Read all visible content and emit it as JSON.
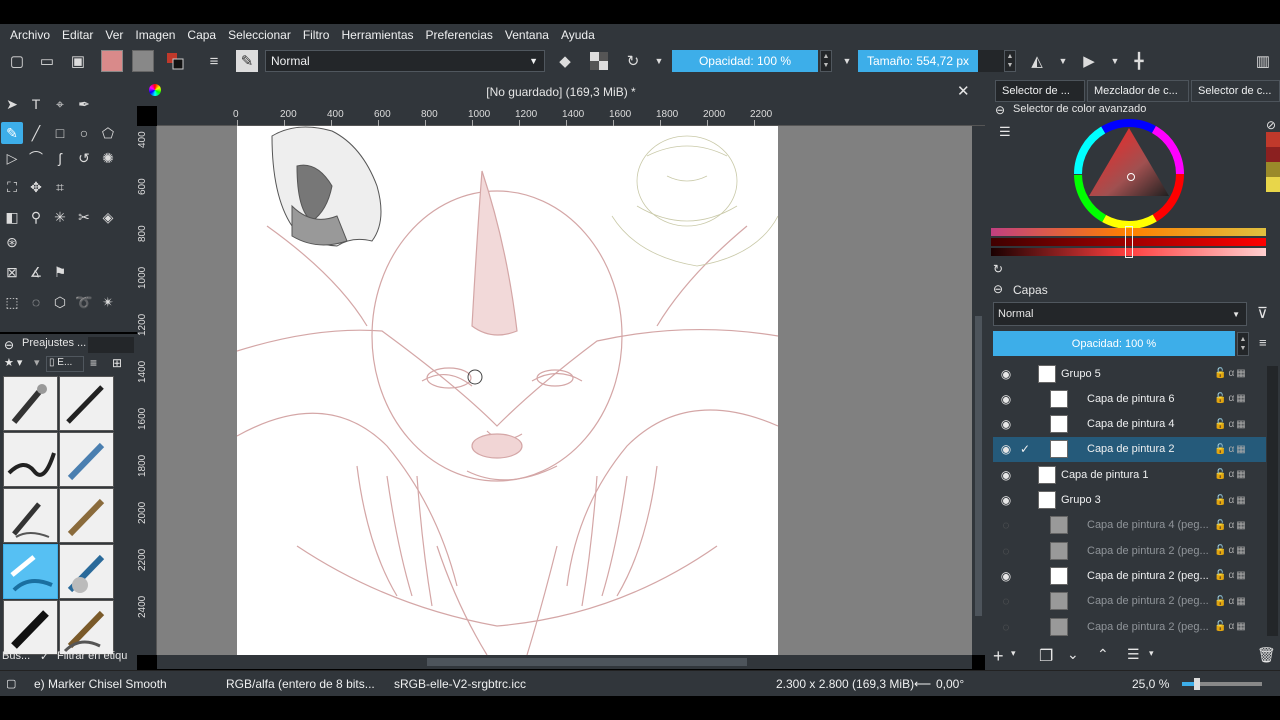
{
  "menu": [
    "Archivo",
    "Editar",
    "Ver",
    "Imagen",
    "Capa",
    "Seleccionar",
    "Filtro",
    "Herramientas",
    "Preferencias",
    "Ventana",
    "Ayuda"
  ],
  "toolbar": {
    "blend_mode": "Normal",
    "opacity_label": "Opacidad: 100 %",
    "size_label": "Tamaño: 554,72 px"
  },
  "document": {
    "title": "[No guardado]  (169,3 MiB) *",
    "close_glyph": "✕"
  },
  "ruler_h": [
    "0",
    "200",
    "400",
    "600",
    "800",
    "1000",
    "1200",
    "1400",
    "1600",
    "1800",
    "2000",
    "2200"
  ],
  "ruler_v": [
    "400",
    "600",
    "800",
    "1000",
    "1200",
    "1400",
    "1600",
    "1800",
    "2000",
    "2200",
    "2400"
  ],
  "presets": {
    "title": "Preajustes ...",
    "tag_label": "E...",
    "search_label": "Bus...",
    "filter_label": "Filtrar en etiqu"
  },
  "dock_tabs": [
    "Selector de ...",
    "Mezclador de c...",
    "Selector de c..."
  ],
  "color_selector": {
    "title": "Selector de color avanzado",
    "swatches": [
      "#c0392b",
      "#8b2020",
      "#9a8a2a",
      "#e8d64a"
    ]
  },
  "layers": {
    "title": "Capas",
    "blend_mode": "Normal",
    "opacity_label": "Opacidad:  100 %",
    "items": [
      {
        "name": "Grupo 5",
        "visible": true,
        "dim": false,
        "selected": false,
        "group": true
      },
      {
        "name": "Capa de pintura 6",
        "visible": true,
        "dim": false,
        "selected": false,
        "group": false
      },
      {
        "name": "Capa de pintura 4",
        "visible": true,
        "dim": false,
        "selected": false,
        "group": false
      },
      {
        "name": "Capa de pintura 2",
        "visible": true,
        "dim": false,
        "selected": true,
        "group": false
      },
      {
        "name": "Capa de pintura 1",
        "visible": true,
        "dim": false,
        "selected": false,
        "group": false
      },
      {
        "name": "Grupo 3",
        "visible": true,
        "dim": false,
        "selected": false,
        "group": true
      },
      {
        "name": "Capa de pintura 4 (peg...",
        "visible": false,
        "dim": true,
        "selected": false,
        "group": false
      },
      {
        "name": "Capa de pintura 2 (peg...",
        "visible": false,
        "dim": true,
        "selected": false,
        "group": false
      },
      {
        "name": "Capa de pintura 2 (peg...",
        "visible": true,
        "dim": false,
        "selected": false,
        "group": false
      },
      {
        "name": "Capa de pintura 2 (peg...",
        "visible": false,
        "dim": true,
        "selected": false,
        "group": false
      },
      {
        "name": "Capa de pintura 2 (peg...",
        "visible": false,
        "dim": true,
        "selected": false,
        "group": false
      }
    ]
  },
  "status": {
    "brush": "e) Marker Chisel Smooth",
    "color_model": "RGB/alfa (entero de 8 bits...",
    "profile": "sRGB-elle-V2-srgbtrc.icc",
    "dimensions": "2.300 x 2.800 (169,3 MiB)",
    "rotation": "0,00°",
    "zoom": "25,0 %"
  },
  "colors": {
    "accent": "#3daee9",
    "panel": "#31363b",
    "sketch": "#c98a8a"
  }
}
